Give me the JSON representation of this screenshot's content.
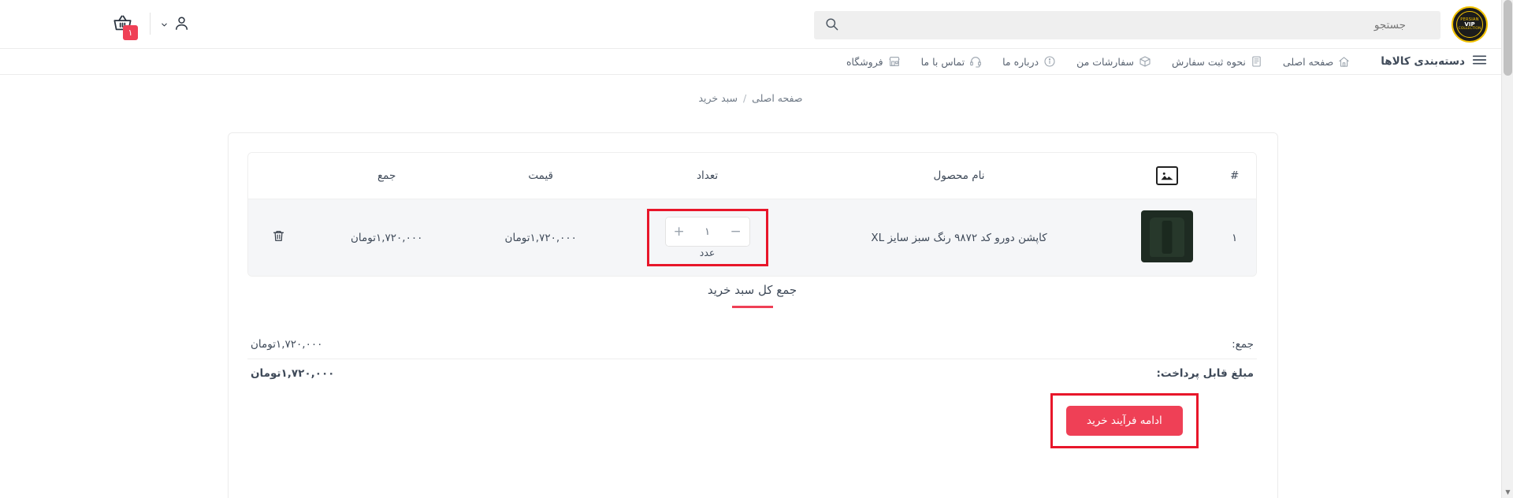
{
  "header": {
    "search": {
      "placeholder": "جستجو",
      "value": "",
      "icon": "search-icon"
    },
    "cart": {
      "icon": "shopping-basket-icon",
      "badge": "۱"
    },
    "account": {
      "icon": "user-icon",
      "chevron": "chevron-down-icon"
    },
    "logo": {
      "top": "PERSIAN",
      "mid": "VIP",
      "bottom": "COLLECTION"
    }
  },
  "nav": {
    "categories": {
      "label": "دسته‌بندی کالاها",
      "icon": "hamburger-menu-icon"
    },
    "items": [
      {
        "label": "صفحه اصلی",
        "icon": "home-icon"
      },
      {
        "label": "نحوه ثبت سفارش",
        "icon": "document-icon"
      },
      {
        "label": "سفارشات من",
        "icon": "box-icon"
      },
      {
        "label": "درباره ما",
        "icon": "info-circle-icon"
      },
      {
        "label": "تماس با ما",
        "icon": "headset-icon"
      },
      {
        "label": "فروشگاه",
        "icon": "store-icon"
      }
    ]
  },
  "breadcrumb": {
    "home": "صفحه اصلی",
    "separator": "/",
    "current": "سبد خرید"
  },
  "cart_table": {
    "headers": {
      "index": "#",
      "image": "",
      "name": "نام محصول",
      "quantity": "تعداد",
      "price": "قیمت",
      "sum": "جمع"
    },
    "image_header_icon": "image-icon",
    "rows": [
      {
        "index": "۱",
        "thumbnail": "product-thumbnail-green-coat",
        "name": "کاپشن دورو کد ۹۸۷۲ رنگ سبز سایز XL",
        "quantity": "۱",
        "quantity_unit": "عدد",
        "decrease_label": "−",
        "increase_label": "+",
        "price": "۱,۷۲۰,۰۰۰تومان",
        "sum": "۱,۷۲۰,۰۰۰تومان",
        "delete_icon": "trash-icon"
      }
    ]
  },
  "totals": {
    "title": "جمع کل سبد خرید",
    "rows": [
      {
        "label": "جمع:",
        "value": "۱,۷۲۰,۰۰۰تومان"
      },
      {
        "label": "مبلغ قابل پرداخت:",
        "value": "۱,۷۲۰,۰۰۰تومان"
      }
    ]
  },
  "checkout": {
    "label": "ادامه فرآیند خرید"
  },
  "colors": {
    "accent_red": "#ef4056",
    "highlight_red": "#e8162a",
    "text": "#3f4a59",
    "muted": "#6d7885",
    "row_bg": "#f5f6f8"
  }
}
